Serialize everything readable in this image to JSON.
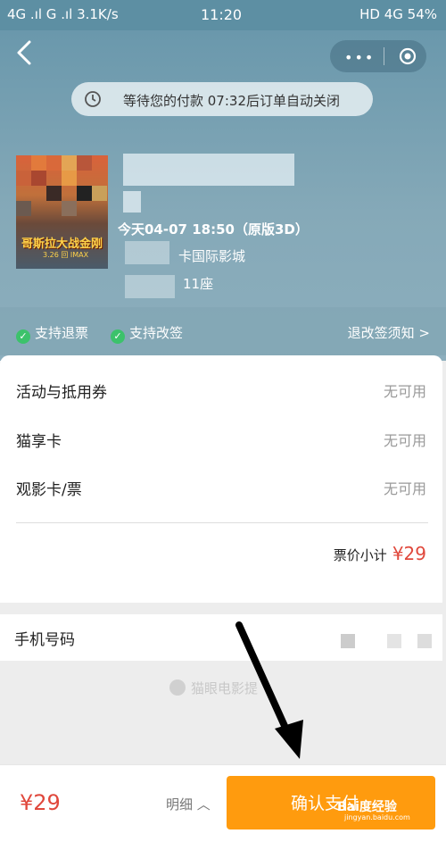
{
  "status_bar": {
    "left": "4G .ıl G .ıl 3.1K/s",
    "time": "11:20",
    "right": "HD 4G 54%"
  },
  "header": {
    "countdown_text": "等待您的付款  07:32后订单自动关闭"
  },
  "movie": {
    "poster_title": "哥斯拉大战金刚",
    "poster_date": "3.26 回 IMAX",
    "showtime": "今天04-07 18:50（原版3D）",
    "cinema": "卡国际影城",
    "seat": "11座"
  },
  "policy": {
    "refund": "支持退票",
    "change": "支持改签",
    "rule_link": "退改签须知 >"
  },
  "order": {
    "rows": [
      {
        "label": "活动与抵用券",
        "value": "无可用"
      },
      {
        "label": "猫享卡",
        "value": "无可用"
      },
      {
        "label": "观影卡/票",
        "value": "无可用"
      }
    ],
    "subtotal_label": "票价小计",
    "subtotal_amount": "¥29"
  },
  "phone": {
    "label": "手机号码"
  },
  "watermark": "猫眼电影提",
  "footer": {
    "price": "¥29",
    "detail": "明细 ︿",
    "pay_label": "确认支付",
    "baidu_mark": "Bai度经验",
    "baidu_url": "jingyan.baidu.com"
  },
  "colors": {
    "accent_orange": "#ff9b0e",
    "price_red": "#e0483c",
    "check_green": "#3cc26b"
  }
}
